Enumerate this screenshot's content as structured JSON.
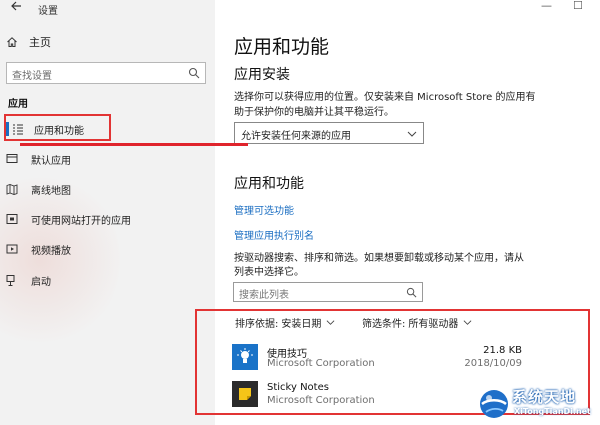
{
  "window": {
    "title": "设置",
    "minimize": "—",
    "maximize": "☐"
  },
  "sidebar": {
    "home_label": "主页",
    "search_placeholder": "查找设置",
    "section_label": "应用",
    "items": [
      {
        "label": "应用和功能",
        "icon": "apps-list-icon",
        "active": true
      },
      {
        "label": "默认应用",
        "icon": "default-apps-icon"
      },
      {
        "label": "离线地图",
        "icon": "offline-maps-icon"
      },
      {
        "label": "可使用网站打开的应用",
        "icon": "website-apps-icon"
      },
      {
        "label": "视频播放",
        "icon": "video-playback-icon"
      },
      {
        "label": "启动",
        "icon": "startup-icon"
      }
    ]
  },
  "main": {
    "title": "应用和功能",
    "install_section": {
      "heading": "应用安装",
      "description_line1": "选择你可以获得应用的位置。仅安装来自 Microsoft Store 的应用有",
      "description_line2": "助于保护你的电脑并让其平稳运行。",
      "dropdown_value": "允许安装任何来源的应用"
    },
    "apps_section": {
      "heading": "应用和功能",
      "link_optional_features": "管理可选功能",
      "link_app_aliases": "管理应用执行别名",
      "description_line1": "按驱动器搜索、排序和筛选。如果想要卸载或移动某个应用，请从",
      "description_line2": "列表中选择它。",
      "search_placeholder": "搜索此列表",
      "sort_label": "排序依据:",
      "sort_value": "安装日期",
      "filter_label": "筛选条件:",
      "filter_value": "所有驱动器"
    },
    "apps": [
      {
        "name": "使用技巧",
        "publisher": "Microsoft Corporation",
        "size": "21.8 KB",
        "date": "2018/10/09",
        "icon": "tips-lightbulb-icon",
        "icon_color": "#1a73c8"
      },
      {
        "name": "Sticky Notes",
        "publisher": "Microsoft Corporation",
        "size": "",
        "date": "",
        "icon": "sticky-notes-icon",
        "icon_color": "#2b2b2b"
      }
    ]
  },
  "watermark": {
    "title": "系统天地",
    "url": "XiTongTianDi.net"
  },
  "colors": {
    "accent": "#1b6ec2",
    "highlight_red": "#e23434"
  }
}
